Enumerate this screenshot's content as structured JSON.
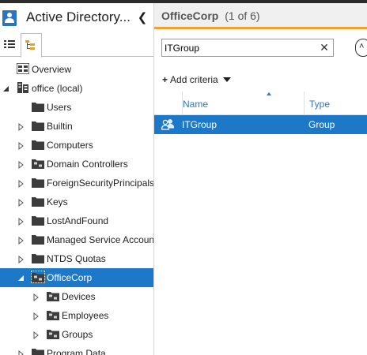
{
  "app": {
    "title": "Active Directory..."
  },
  "nav": {
    "collapse_glyph": "❮",
    "view_tabs": [
      {
        "name": "list-view",
        "icon": "list-icon"
      },
      {
        "name": "tree-view",
        "icon": "tree-icon",
        "selected": true
      }
    ],
    "tree": [
      {
        "label": "Overview",
        "icon": "overview-icon",
        "expander": "none",
        "depth": 0
      },
      {
        "label": "office (local)",
        "icon": "domain-icon",
        "expander": "expanded",
        "depth": 0
      },
      {
        "label": "Users",
        "icon": "folder-icon",
        "expander": "none",
        "depth": 1
      },
      {
        "label": "Builtin",
        "icon": "folder-icon",
        "expander": "collapsed",
        "depth": 1
      },
      {
        "label": "Computers",
        "icon": "folder-icon",
        "expander": "collapsed",
        "depth": 1
      },
      {
        "label": "Domain Controllers",
        "icon": "ou-icon",
        "expander": "collapsed",
        "depth": 1
      },
      {
        "label": "ForeignSecurityPrincipals",
        "icon": "folder-icon",
        "expander": "collapsed",
        "depth": 1
      },
      {
        "label": "Keys",
        "icon": "folder-icon",
        "expander": "collapsed",
        "depth": 1
      },
      {
        "label": "LostAndFound",
        "icon": "folder-icon",
        "expander": "collapsed",
        "depth": 1
      },
      {
        "label": "Managed Service Accoun",
        "icon": "folder-icon",
        "expander": "collapsed",
        "depth": 1
      },
      {
        "label": "NTDS Quotas",
        "icon": "folder-icon",
        "expander": "collapsed",
        "depth": 1
      },
      {
        "label": "OfficeCorp",
        "icon": "ou-icon",
        "expander": "expanded",
        "depth": 1,
        "selected": true
      },
      {
        "label": "Devices",
        "icon": "ou-icon",
        "expander": "collapsed",
        "depth": 2
      },
      {
        "label": "Employees",
        "icon": "ou-icon",
        "expander": "collapsed",
        "depth": 2
      },
      {
        "label": "Groups",
        "icon": "ou-icon",
        "expander": "collapsed",
        "depth": 2
      },
      {
        "label": "Program Data",
        "icon": "folder-icon",
        "expander": "collapsed",
        "depth": 1
      }
    ]
  },
  "content": {
    "title": "OfficeCorp",
    "count": "(1 of 6)",
    "accent_color": "#f2a12e",
    "search": {
      "value": "ITGroup",
      "placeholder": "",
      "clear_glyph": "✕"
    },
    "add_criteria_plus": "+",
    "add_criteria_label": "Add criteria",
    "columns": [
      {
        "label": "Name",
        "sorted": "ascending"
      },
      {
        "label": "Type"
      }
    ],
    "rows": [
      {
        "name": "ITGroup",
        "type": "Group",
        "icon": "group-icon",
        "selected": true
      }
    ]
  },
  "colors": {
    "selection": "#1e78c8",
    "header_link": "#3a73b5",
    "app_icon": "#2a74c5"
  }
}
